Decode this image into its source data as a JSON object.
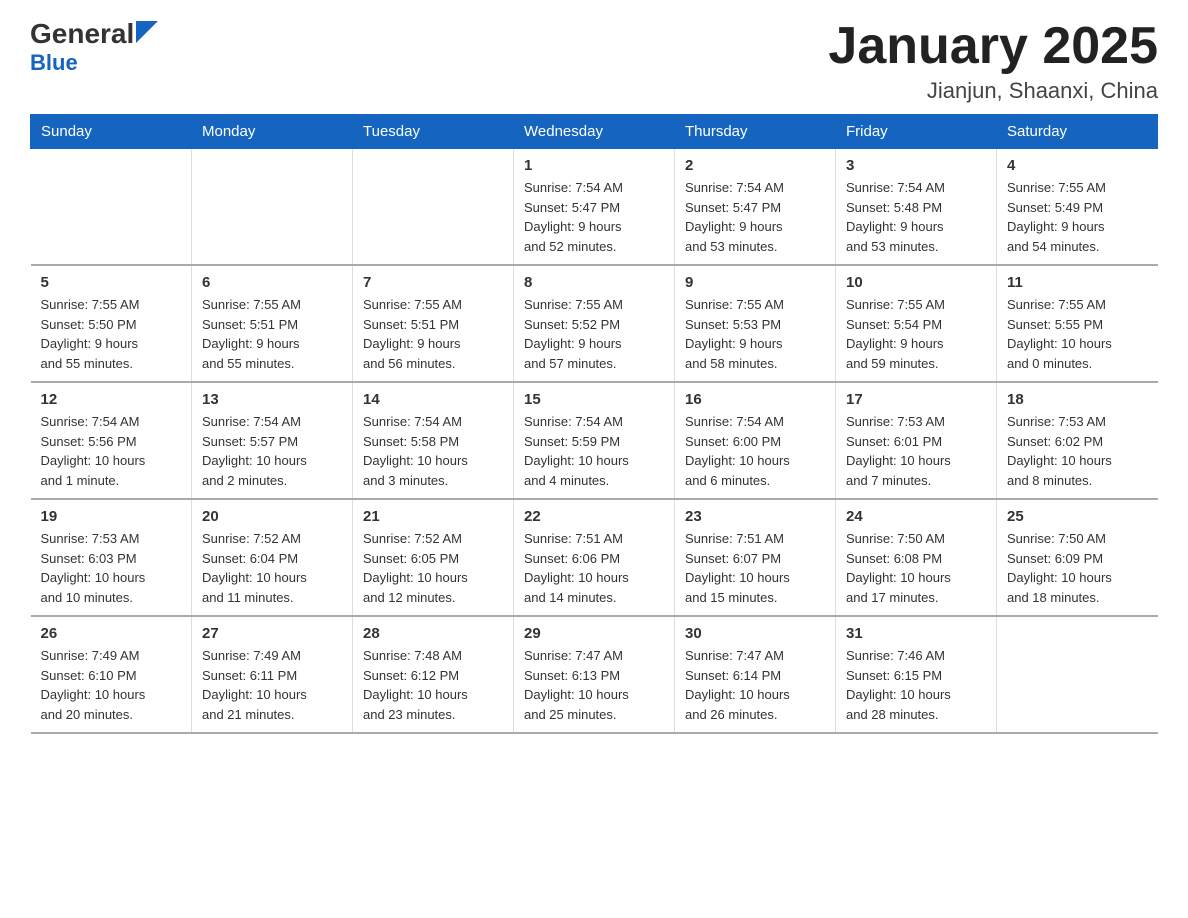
{
  "logo": {
    "name_part1": "General",
    "name_part2": "Blue"
  },
  "title": "January 2025",
  "subtitle": "Jianjun, Shaanxi, China",
  "days_of_week": [
    "Sunday",
    "Monday",
    "Tuesday",
    "Wednesday",
    "Thursday",
    "Friday",
    "Saturday"
  ],
  "weeks": [
    [
      {
        "day": "",
        "info": ""
      },
      {
        "day": "",
        "info": ""
      },
      {
        "day": "",
        "info": ""
      },
      {
        "day": "1",
        "info": "Sunrise: 7:54 AM\nSunset: 5:47 PM\nDaylight: 9 hours\nand 52 minutes."
      },
      {
        "day": "2",
        "info": "Sunrise: 7:54 AM\nSunset: 5:47 PM\nDaylight: 9 hours\nand 53 minutes."
      },
      {
        "day": "3",
        "info": "Sunrise: 7:54 AM\nSunset: 5:48 PM\nDaylight: 9 hours\nand 53 minutes."
      },
      {
        "day": "4",
        "info": "Sunrise: 7:55 AM\nSunset: 5:49 PM\nDaylight: 9 hours\nand 54 minutes."
      }
    ],
    [
      {
        "day": "5",
        "info": "Sunrise: 7:55 AM\nSunset: 5:50 PM\nDaylight: 9 hours\nand 55 minutes."
      },
      {
        "day": "6",
        "info": "Sunrise: 7:55 AM\nSunset: 5:51 PM\nDaylight: 9 hours\nand 55 minutes."
      },
      {
        "day": "7",
        "info": "Sunrise: 7:55 AM\nSunset: 5:51 PM\nDaylight: 9 hours\nand 56 minutes."
      },
      {
        "day": "8",
        "info": "Sunrise: 7:55 AM\nSunset: 5:52 PM\nDaylight: 9 hours\nand 57 minutes."
      },
      {
        "day": "9",
        "info": "Sunrise: 7:55 AM\nSunset: 5:53 PM\nDaylight: 9 hours\nand 58 minutes."
      },
      {
        "day": "10",
        "info": "Sunrise: 7:55 AM\nSunset: 5:54 PM\nDaylight: 9 hours\nand 59 minutes."
      },
      {
        "day": "11",
        "info": "Sunrise: 7:55 AM\nSunset: 5:55 PM\nDaylight: 10 hours\nand 0 minutes."
      }
    ],
    [
      {
        "day": "12",
        "info": "Sunrise: 7:54 AM\nSunset: 5:56 PM\nDaylight: 10 hours\nand 1 minute."
      },
      {
        "day": "13",
        "info": "Sunrise: 7:54 AM\nSunset: 5:57 PM\nDaylight: 10 hours\nand 2 minutes."
      },
      {
        "day": "14",
        "info": "Sunrise: 7:54 AM\nSunset: 5:58 PM\nDaylight: 10 hours\nand 3 minutes."
      },
      {
        "day": "15",
        "info": "Sunrise: 7:54 AM\nSunset: 5:59 PM\nDaylight: 10 hours\nand 4 minutes."
      },
      {
        "day": "16",
        "info": "Sunrise: 7:54 AM\nSunset: 6:00 PM\nDaylight: 10 hours\nand 6 minutes."
      },
      {
        "day": "17",
        "info": "Sunrise: 7:53 AM\nSunset: 6:01 PM\nDaylight: 10 hours\nand 7 minutes."
      },
      {
        "day": "18",
        "info": "Sunrise: 7:53 AM\nSunset: 6:02 PM\nDaylight: 10 hours\nand 8 minutes."
      }
    ],
    [
      {
        "day": "19",
        "info": "Sunrise: 7:53 AM\nSunset: 6:03 PM\nDaylight: 10 hours\nand 10 minutes."
      },
      {
        "day": "20",
        "info": "Sunrise: 7:52 AM\nSunset: 6:04 PM\nDaylight: 10 hours\nand 11 minutes."
      },
      {
        "day": "21",
        "info": "Sunrise: 7:52 AM\nSunset: 6:05 PM\nDaylight: 10 hours\nand 12 minutes."
      },
      {
        "day": "22",
        "info": "Sunrise: 7:51 AM\nSunset: 6:06 PM\nDaylight: 10 hours\nand 14 minutes."
      },
      {
        "day": "23",
        "info": "Sunrise: 7:51 AM\nSunset: 6:07 PM\nDaylight: 10 hours\nand 15 minutes."
      },
      {
        "day": "24",
        "info": "Sunrise: 7:50 AM\nSunset: 6:08 PM\nDaylight: 10 hours\nand 17 minutes."
      },
      {
        "day": "25",
        "info": "Sunrise: 7:50 AM\nSunset: 6:09 PM\nDaylight: 10 hours\nand 18 minutes."
      }
    ],
    [
      {
        "day": "26",
        "info": "Sunrise: 7:49 AM\nSunset: 6:10 PM\nDaylight: 10 hours\nand 20 minutes."
      },
      {
        "day": "27",
        "info": "Sunrise: 7:49 AM\nSunset: 6:11 PM\nDaylight: 10 hours\nand 21 minutes."
      },
      {
        "day": "28",
        "info": "Sunrise: 7:48 AM\nSunset: 6:12 PM\nDaylight: 10 hours\nand 23 minutes."
      },
      {
        "day": "29",
        "info": "Sunrise: 7:47 AM\nSunset: 6:13 PM\nDaylight: 10 hours\nand 25 minutes."
      },
      {
        "day": "30",
        "info": "Sunrise: 7:47 AM\nSunset: 6:14 PM\nDaylight: 10 hours\nand 26 minutes."
      },
      {
        "day": "31",
        "info": "Sunrise: 7:46 AM\nSunset: 6:15 PM\nDaylight: 10 hours\nand 28 minutes."
      },
      {
        "day": "",
        "info": ""
      }
    ]
  ]
}
